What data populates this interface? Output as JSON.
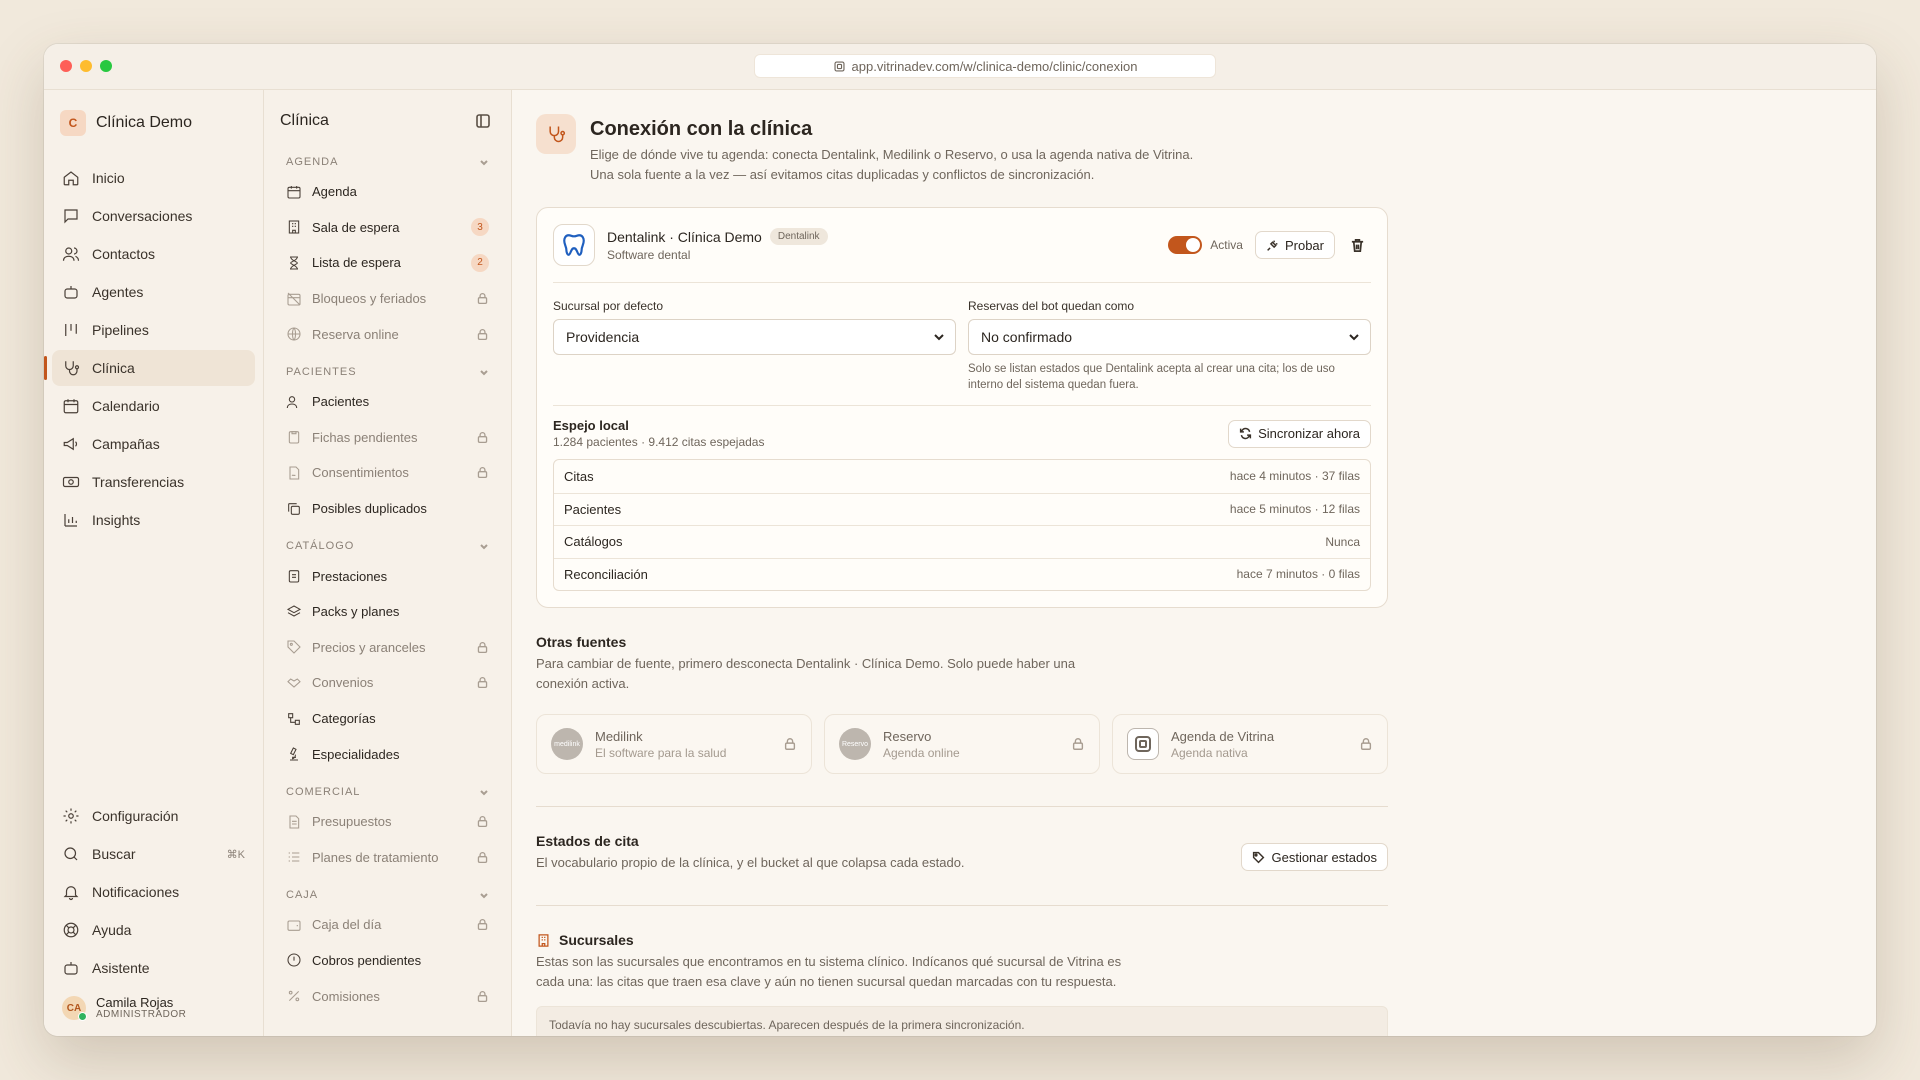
{
  "browser": {
    "url": "app.vitrinadev.com/w/clinica-demo/clinic/conexion"
  },
  "org": {
    "initial": "C",
    "name": "Clínica Demo"
  },
  "nav": {
    "items": [
      "Inicio",
      "Conversaciones",
      "Contactos",
      "Agentes",
      "Pipelines",
      "Clínica",
      "Calendario",
      "Campañas",
      "Transferencias",
      "Insights"
    ],
    "bottom": [
      "Configuración",
      "Buscar",
      "Notificaciones",
      "Ayuda",
      "Asistente"
    ],
    "search_shortcut": "⌘K"
  },
  "user": {
    "initials": "CA",
    "name": "Camila Rojas",
    "role": "ADMINISTRADOR"
  },
  "subnav": {
    "title": "Clínica",
    "sections": {
      "agenda": {
        "label": "AGENDA",
        "items": [
          "Agenda",
          "Sala de espera",
          "Lista de espera",
          "Bloqueos y feriados",
          "Reserva online"
        ],
        "badges": [
          "3",
          "2"
        ]
      },
      "pacientes": {
        "label": "PACIENTES",
        "items": [
          "Pacientes",
          "Fichas pendientes",
          "Consentimientos",
          "Posibles duplicados"
        ]
      },
      "catalogo": {
        "label": "CATÁLOGO",
        "items": [
          "Prestaciones",
          "Packs y planes",
          "Precios y aranceles",
          "Convenios",
          "Categorías",
          "Especialidades"
        ]
      },
      "comercial": {
        "label": "COMERCIAL",
        "items": [
          "Presupuestos",
          "Planes de tratamiento"
        ]
      },
      "caja": {
        "label": "CAJA",
        "items": [
          "Caja del día",
          "Cobros pendientes",
          "Comisiones"
        ]
      }
    }
  },
  "page": {
    "title": "Conexión con la clínica",
    "desc1": "Elige de dónde vive tu agenda: conecta Dentalink, Medilink o Reservo, o usa la agenda nativa de Vitrina.",
    "desc2": "Una sola fuente a la vez — así evitamos citas duplicadas y conflictos de sincronización."
  },
  "connection": {
    "name": "Dentalink · Clínica Demo",
    "tag": "Dentalink",
    "subtitle": "Software dental",
    "status_label": "Activa",
    "test_label": "Probar",
    "branch_label": "Sucursal por defecto",
    "branch_value": "Providencia",
    "bookings_label": "Reservas del bot quedan como",
    "bookings_value": "No confirmado",
    "bookings_hint": "Solo se listan estados que Dentalink acepta al crear una cita; los de uso interno del sistema quedan fuera.",
    "mirror_title": "Espejo local",
    "mirror_sub": "1.284 pacientes · 9.412 citas espejadas",
    "sync_label": "Sincronizar ahora",
    "mirror_rows": [
      {
        "k": "Citas",
        "v": "hace 4 minutos · 37 filas"
      },
      {
        "k": "Pacientes",
        "v": "hace 5 minutos · 12 filas"
      },
      {
        "k": "Catálogos",
        "v": "Nunca"
      },
      {
        "k": "Reconciliación",
        "v": "hace 7 minutos · 0 filas"
      }
    ]
  },
  "other_sources": {
    "title": "Otras fuentes",
    "desc1": "Para cambiar de fuente, primero desconecta Dentalink · Clínica Demo. Solo puede haber una",
    "desc2": "conexión activa.",
    "items": [
      {
        "name": "Medilink",
        "sub": "El software para la salud",
        "logo": "medilink"
      },
      {
        "name": "Reservo",
        "sub": "Agenda online",
        "logo": "Reservo"
      },
      {
        "name": "Agenda de Vitrina",
        "sub": "Agenda nativa"
      }
    ]
  },
  "states": {
    "title": "Estados de cita",
    "desc": "El vocabulario propio de la clínica, y el bucket al que colapsa cada estado.",
    "button": "Gestionar estados"
  },
  "branches": {
    "title": "Sucursales",
    "desc1": "Estas son las sucursales que encontramos en tu sistema clínico. Indícanos qué sucursal de Vitrina es",
    "desc2": "cada una: las citas que traen esa clave y aún no tienen sucursal quedan marcadas con tu respuesta.",
    "empty": "Todavía no hay sucursales descubiertas. Aparecen después de la primera sincronización."
  },
  "colors": {
    "accent": "#c2561c",
    "background": "#f1e9dc",
    "panel": "#faf6f0"
  }
}
